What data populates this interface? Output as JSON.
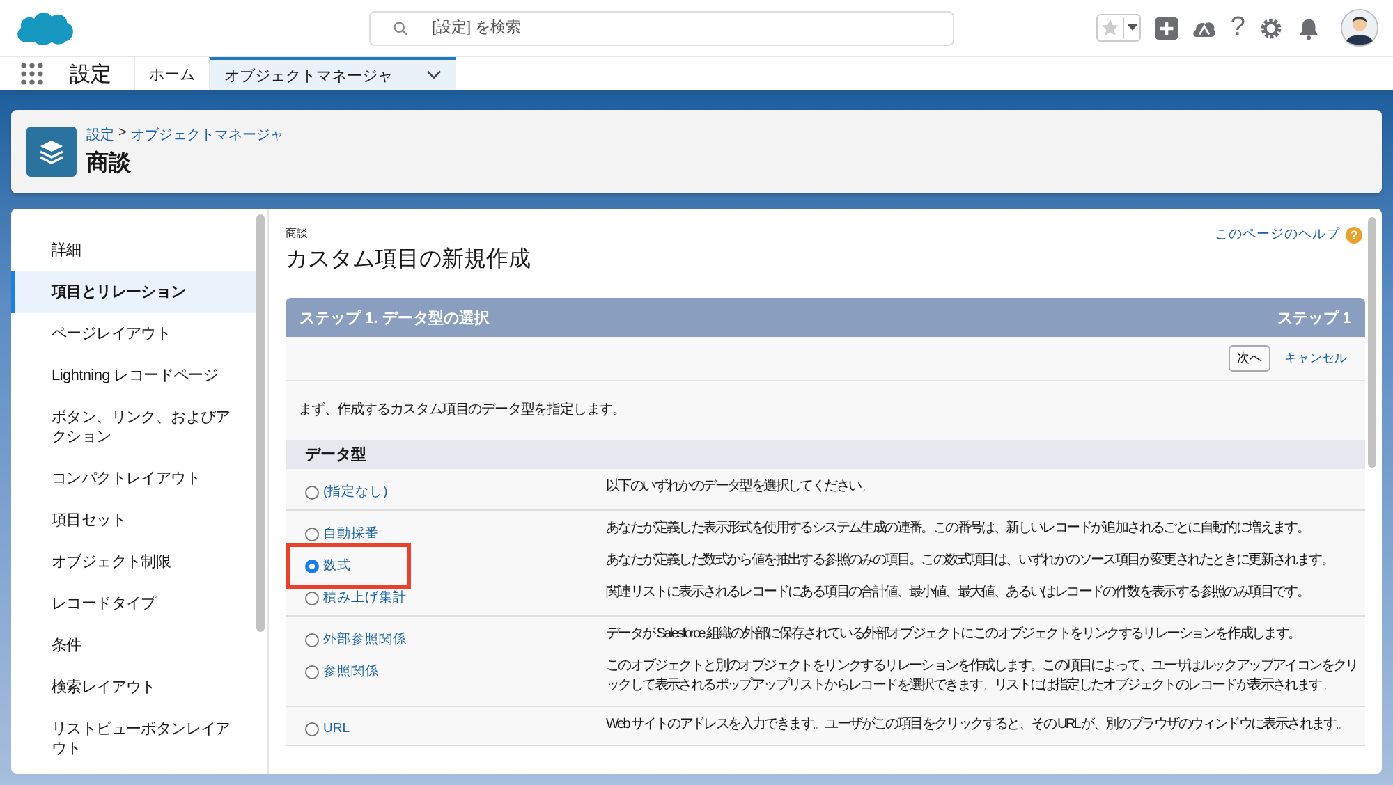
{
  "header": {
    "search": {
      "placeholder": "[設定] を検索"
    },
    "help_glyph": "?"
  },
  "nav": {
    "app_name": "設定",
    "tabs": [
      {
        "label": "ホーム",
        "selected": false
      },
      {
        "label": "オブジェクトマネージャ",
        "selected": true
      }
    ]
  },
  "page_header": {
    "breadcrumb": [
      "設定",
      "オブジェクトマネージャ"
    ],
    "separator": ">",
    "title": "商談"
  },
  "sidebar": {
    "items": [
      {
        "label": "詳細",
        "selected": false
      },
      {
        "label": "項目とリレーション",
        "selected": true
      },
      {
        "label": "ページレイアウト",
        "selected": false
      },
      {
        "label": "Lightning レコードページ",
        "selected": false
      },
      {
        "label": "ボタン、リンク、およびアクション",
        "selected": false
      },
      {
        "label": "コンパクトレイアウト",
        "selected": false
      },
      {
        "label": "項目セット",
        "selected": false
      },
      {
        "label": "オブジェクト制限",
        "selected": false
      },
      {
        "label": "レコードタイプ",
        "selected": false
      },
      {
        "label": "条件",
        "selected": false
      },
      {
        "label": "検索レイアウト",
        "selected": false
      },
      {
        "label": "リストビューボタンレイアウト",
        "selected": false
      }
    ]
  },
  "main": {
    "object_label": "商談",
    "title": "カスタム項目の新規作成",
    "help_link": "このページのヘルプ",
    "help_icon": "?",
    "step": {
      "title": "ステップ 1. データ型の選択",
      "step_label": "ステップ 1",
      "buttons": {
        "next": "次へ",
        "cancel": "キャンセル"
      },
      "intro": "まず、作成するカスタム項目のデータ型を指定します。",
      "section": "データ型",
      "groups": [
        {
          "options": [
            {
              "label": "(指定なし)",
              "selected": false,
              "highlighted": false,
              "description": "以下のいずれかのデータ型を選択してください。"
            }
          ]
        },
        {
          "options": [
            {
              "label": "自動採番",
              "selected": false,
              "highlighted": false,
              "description": "あなたが定義した表示形式を使用するシステム生成の連番。この番号は、新しいレコードが追加されるごとに自動的に増えます。"
            },
            {
              "label": "数式",
              "selected": true,
              "highlighted": true,
              "description": "あなたが定義した数式から値を抽出する参照のみの項目。この数式項目は、いずれかのソース項目が変更されたときに更新されます。"
            },
            {
              "label": "積み上げ集計",
              "selected": false,
              "highlighted": false,
              "description": "関連リストに表示されるレコードにある項目の合計値、最小値、最大値、あるいはレコードの件数を表示する参照のみ項目です。"
            }
          ]
        },
        {
          "options": [
            {
              "label": "外部参照関係",
              "selected": false,
              "highlighted": false,
              "description": "データが Salesforce 組織の外部に保存されている外部オブジェクトにこのオブジェクトをリンクするリレーションを作成します。"
            },
            {
              "label": "参照関係",
              "selected": false,
              "highlighted": false,
              "description": "このオブジェクトと別のオブジェクトをリンクするリレーションを作成します。この項目によって、ユーザはルックアップアイコンをクリックして表示されるポップアップリストからレコードを選択できます。リストには指定したオブジェクトのレコードが表示されます。"
            }
          ]
        },
        {
          "options": [
            {
              "label": "URL",
              "selected": false,
              "highlighted": false,
              "description": "Web サイトのアドレスを入力できます。ユーザがこの項目をクリックすると、その URL が、別のブラウザのウィンドウに表示されます。"
            }
          ]
        }
      ]
    }
  }
}
